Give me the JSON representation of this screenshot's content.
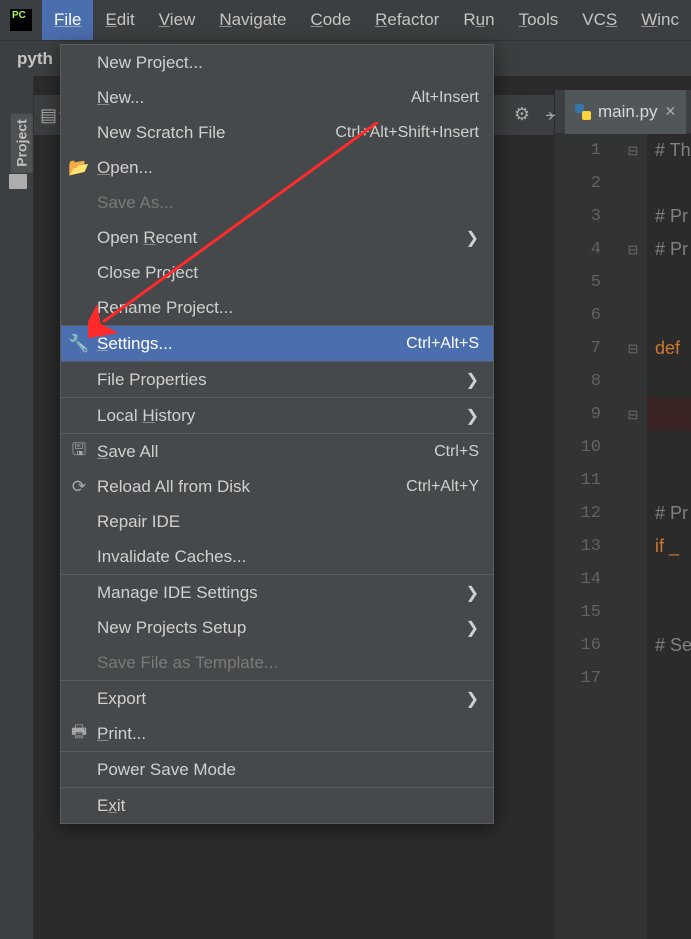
{
  "menubar": {
    "items": [
      "File",
      "Edit",
      "View",
      "Navigate",
      "Code",
      "Refactor",
      "Run",
      "Tools",
      "VCS",
      "Window"
    ]
  },
  "toolbar": {
    "project_root": "pyth"
  },
  "sidebar": {
    "project_label": "Project"
  },
  "file_menu": {
    "items": [
      {
        "label": "New Project..."
      },
      {
        "label": "New...",
        "mn": 0,
        "shortcut": "Alt+Insert"
      },
      {
        "label": "New Scratch File",
        "shortcut": "Ctrl+Alt+Shift+Insert"
      },
      {
        "label": "Open...",
        "mn": 0,
        "icon": "folder"
      },
      {
        "label": "Save As...",
        "disabled": true
      },
      {
        "label": "Open Recent",
        "mn": 5,
        "sub": true
      },
      {
        "label": "Close Project"
      },
      {
        "label": "Rename Project..."
      },
      {
        "sep": true
      },
      {
        "label": "Settings...",
        "mn": 0,
        "shortcut": "Ctrl+Alt+S",
        "icon": "wrench",
        "highlight": true
      },
      {
        "sep": true
      },
      {
        "label": "File Properties",
        "sub": true
      },
      {
        "sep": true
      },
      {
        "label": "Local History",
        "mn": 6,
        "sub": true
      },
      {
        "sep": true
      },
      {
        "label": "Save All",
        "mn": 0,
        "shortcut": "Ctrl+S",
        "icon": "save"
      },
      {
        "label": "Reload All from Disk",
        "shortcut": "Ctrl+Alt+Y",
        "icon": "reload"
      },
      {
        "label": "Repair IDE"
      },
      {
        "label": "Invalidate Caches..."
      },
      {
        "sep": true
      },
      {
        "label": "Manage IDE Settings",
        "sub": true
      },
      {
        "label": "New Projects Setup",
        "sub": true
      },
      {
        "label": "Save File as Template...",
        "disabled": true
      },
      {
        "sep": true
      },
      {
        "label": "Export",
        "sub": true
      },
      {
        "label": "Print...",
        "mn": 0,
        "icon": "print"
      },
      {
        "sep": true
      },
      {
        "label": "Power Save Mode"
      },
      {
        "sep": true
      },
      {
        "label": "Exit",
        "mn": 1
      }
    ]
  },
  "editor": {
    "tab_name": "main.py",
    "lines": [
      {
        "n": "1",
        "fold": "⊟",
        "t": "# Th",
        "cls": "c-cm"
      },
      {
        "n": "2",
        "t": ""
      },
      {
        "n": "3",
        "t": "# Pr",
        "cls": "c-cm"
      },
      {
        "n": "4",
        "fold": "⊟",
        "t": "# Pr",
        "cls": "c-cm"
      },
      {
        "n": "5",
        "t": ""
      },
      {
        "n": "6",
        "t": ""
      },
      {
        "n": "7",
        "fold": "⊟",
        "t": "def ",
        "cls": "c-kw"
      },
      {
        "n": "8",
        "t": ""
      },
      {
        "n": "9",
        "fold": "⊟",
        "bp": true,
        "t": ""
      },
      {
        "n": "10",
        "t": ""
      },
      {
        "n": "11",
        "t": ""
      },
      {
        "n": "12",
        "t": "# Pr",
        "cls": "c-cm"
      },
      {
        "n": "13",
        "run": true,
        "t": "if _",
        "cls": "c-kw"
      },
      {
        "n": "14",
        "t": ""
      },
      {
        "n": "15",
        "t": ""
      },
      {
        "n": "16",
        "t": "# Se",
        "cls": "c-cm"
      },
      {
        "n": "17",
        "t": ""
      }
    ]
  }
}
